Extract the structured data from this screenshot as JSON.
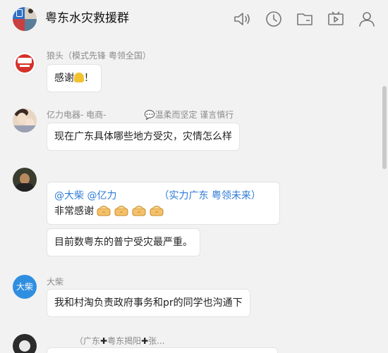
{
  "header": {
    "group_name": "粤东水灾救援群",
    "icons": [
      "speaker-icon",
      "history-icon",
      "folder-icon",
      "video-icon",
      "members-icon"
    ]
  },
  "messages": [
    {
      "sender": "狼头（模式先锋 粤领全国）",
      "avatar": "logo",
      "bubbles": [
        {
          "text": "感谢",
          "emoji": "folded-hands",
          "suffix": "！"
        }
      ]
    },
    {
      "sender": "亿力电器- 电商-",
      "sender_extra": "温柔而坚定 谨言慎行",
      "avatar": "photo",
      "bubbles": [
        {
          "text": "现在广东具体哪些地方受灾，灾情怎么样"
        }
      ]
    },
    {
      "sender": "",
      "avatar": "photo",
      "bubbles": [
        {
          "mention1": "@大柴",
          "mention2": "@亿力",
          "mention3": "（实力广东 粤领未来）",
          "text": "非常感谢",
          "emoji": "gift",
          "emoji_count": 4
        },
        {
          "text": "目前数粤东的普宁受灾最严重。"
        }
      ]
    },
    {
      "sender": "大柴",
      "avatar": "text",
      "avatar_text": "大柴",
      "bubbles": [
        {
          "text": "我和村淘负责政府事务和pr的同学也沟通下"
        }
      ]
    },
    {
      "sender_part1": "（广东",
      "sender_part2": "粤东揭阳",
      "sender_part3": "张...",
      "avatar": "dark"
    }
  ],
  "colors": {
    "accent": "#2f8ee0",
    "mention": "#2f7bd6",
    "background": "#f2f2f2",
    "bubble": "#ffffff"
  }
}
